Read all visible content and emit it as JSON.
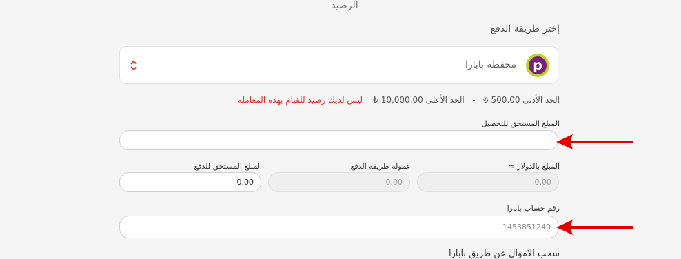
{
  "balance_label": "الرصيد",
  "payment_method": {
    "section_title": "إختر طريقة الدفع",
    "selected_wallet": "محفظة بابارا",
    "logo_letter": "p",
    "colors": {
      "logo_ring": "#b8d431",
      "logo_inner": "#7b1f7e",
      "chevron": "#e32b2b"
    }
  },
  "limits": {
    "min_text": "الحد الأدنى 500.00 ₺",
    "separator": "-",
    "max_text": "الحد الأعلى 10,000.00 ₺",
    "error_text": "ليس لديك رصيد للقيام بهذه المعاملة",
    "error_color": "#e32b2b"
  },
  "amount_due_field": {
    "label": "المبلغ المستحق للتحصيل",
    "value": ""
  },
  "usd_field": {
    "label": "المبلغ بالدولار ≈",
    "value": "0.00"
  },
  "commission_field": {
    "label": "عمولة طريقة الدفع",
    "value": "0.00"
  },
  "payable_field": {
    "label": "المبلغ المستحق للدفع",
    "value": "0.00"
  },
  "account_field": {
    "label": "رقم حساب بابارا",
    "value": "1453851240"
  },
  "footer_partial_text": "سحب الاموال عن طريق بابارا",
  "annotation_color": "#e00000"
}
